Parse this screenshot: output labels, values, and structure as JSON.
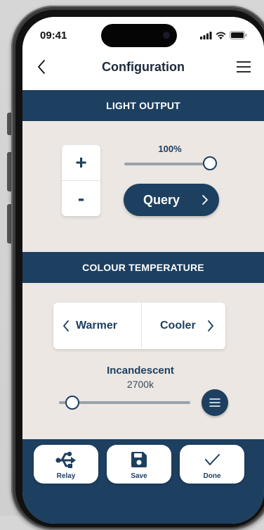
{
  "status_bar": {
    "time": "09:41"
  },
  "nav": {
    "title": "Configuration"
  },
  "light_output": {
    "header": "LIGHT OUTPUT",
    "plus_label": "+",
    "minus_label": "-",
    "level_text": "100%",
    "level_fraction": 1.0,
    "query_label": "Query"
  },
  "colour_temperature": {
    "header": "COLOUR TEMPERATURE",
    "warmer_label": "Warmer",
    "cooler_label": "Cooler",
    "preset_name": "Incandescent",
    "value_text": "2700k",
    "slider_fraction": 0.1
  },
  "toolbar": {
    "relay_label": "Relay",
    "save_label": "Save",
    "done_label": "Done"
  },
  "colors": {
    "accent": "#1d3f60",
    "panel_bg": "#ece7e3",
    "track": "#9aa2ab"
  },
  "icons": [
    "back-chevron-icon",
    "hamburger-menu-icon",
    "chevron-right-icon",
    "chevron-left-icon",
    "list-icon",
    "usb-relay-icon",
    "save-floppy-icon",
    "checkmark-icon"
  ]
}
